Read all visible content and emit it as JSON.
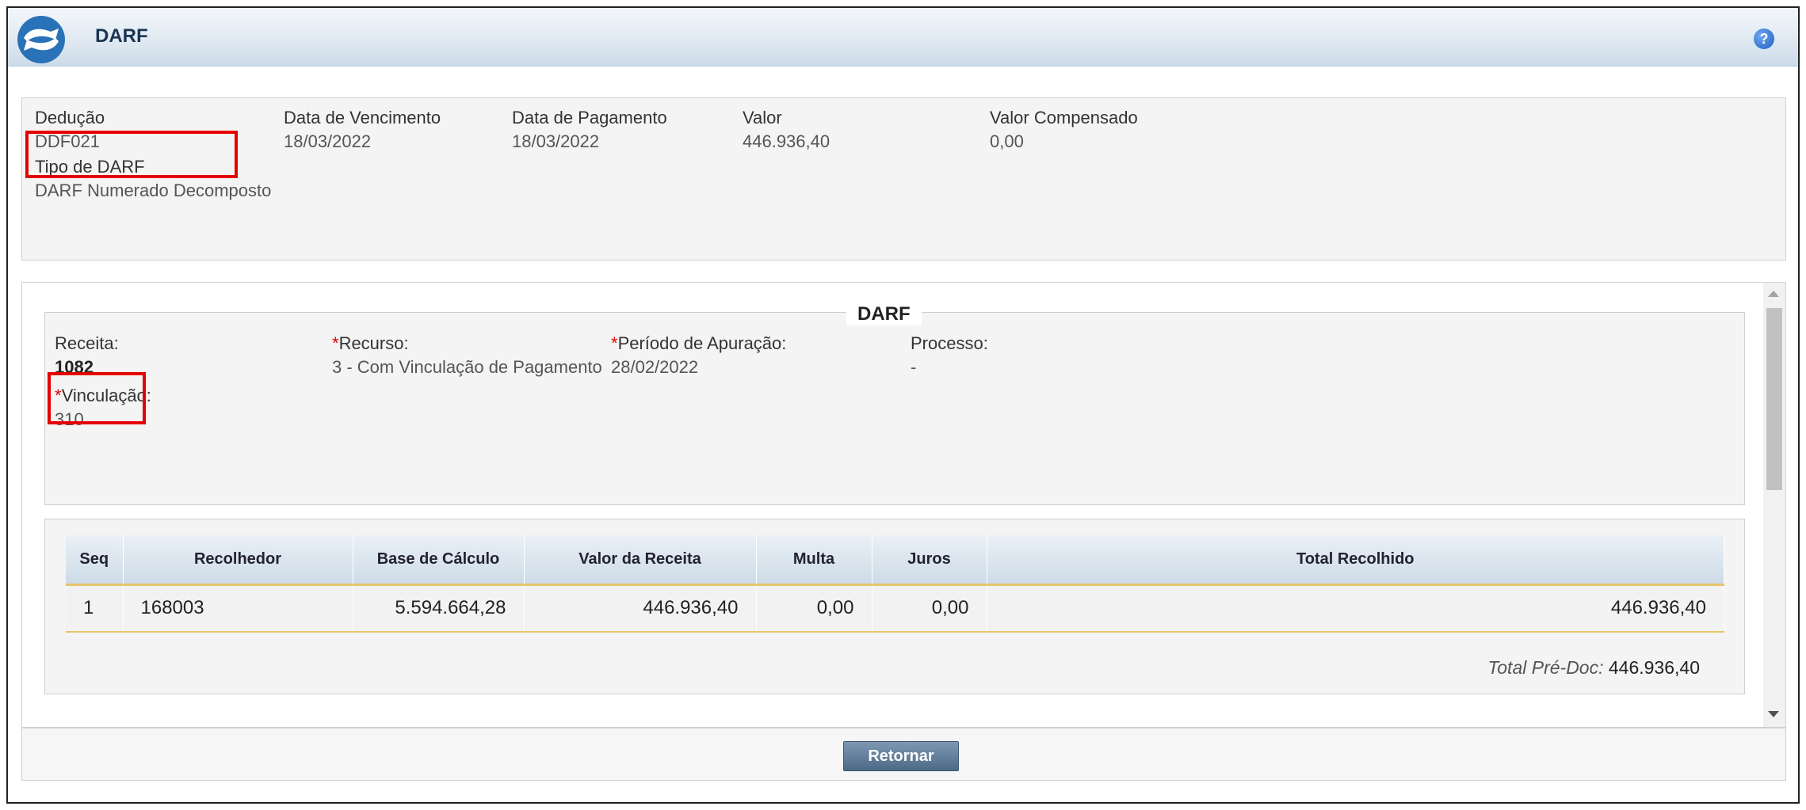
{
  "header": {
    "title": "DARF",
    "help_icon": "help-icon"
  },
  "summary": {
    "deducao": {
      "label": "Dedução",
      "value": "DDF021"
    },
    "data_vencimento": {
      "label": "Data de Vencimento",
      "value": "18/03/2022"
    },
    "data_pagamento": {
      "label": "Data de Pagamento",
      "value": "18/03/2022"
    },
    "valor": {
      "label": "Valor",
      "value": "446.936,40"
    },
    "valor_compensado": {
      "label": "Valor Compensado",
      "value": "0,00"
    },
    "tipo_darf": {
      "label": "Tipo de DARF",
      "value": "DARF Numerado Decomposto"
    }
  },
  "darf": {
    "legend": "DARF",
    "receita": {
      "label": "Receita:",
      "value": "1082"
    },
    "recurso": {
      "label": "Recurso:",
      "value": "3 - Com Vinculação de Pagamento"
    },
    "periodo": {
      "label": "Período de Apuração:",
      "value": "28/02/2022"
    },
    "processo": {
      "label": "Processo:",
      "value": "-"
    },
    "vinculacao": {
      "label": "Vinculação:",
      "value": "310"
    },
    "required_mark": "*"
  },
  "table": {
    "columns": [
      "Seq",
      "Recolhedor",
      "Base de Cálculo",
      "Valor da Receita",
      "Multa",
      "Juros",
      "Total Recolhido"
    ],
    "rows": [
      [
        "1",
        "168003",
        "5.594.664,28",
        "446.936,40",
        "0,00",
        "0,00",
        "446.936,40"
      ]
    ],
    "total_pre_doc_label": "Total Pré-Doc:",
    "total_pre_doc_value": "446.936,40"
  },
  "footer": {
    "retornar_label": "Retornar"
  },
  "colors": {
    "highlight": "#e50000",
    "button": "#5b7896",
    "header_bg": "#dfe8f1"
  }
}
